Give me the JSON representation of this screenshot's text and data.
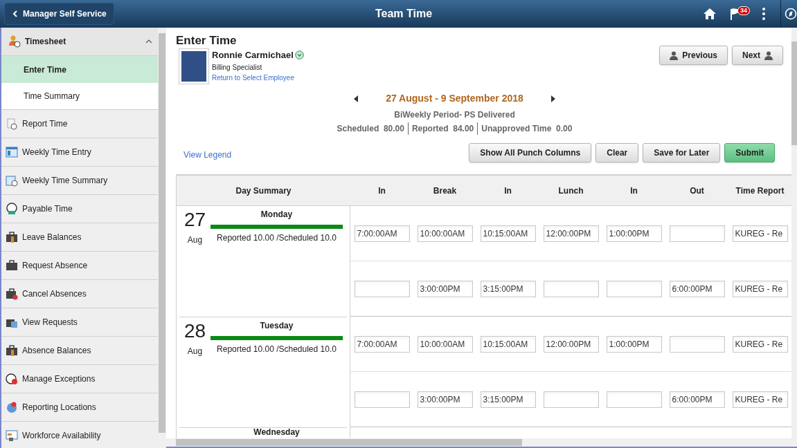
{
  "header": {
    "back_button": "Manager Self Service",
    "title": "Team Time",
    "notification_count": "34"
  },
  "sidebar": {
    "group": {
      "label": "Timesheet",
      "expanded": true,
      "children": [
        {
          "label": "Enter Time",
          "selected": true
        },
        {
          "label": "Time Summary",
          "selected": false
        }
      ]
    },
    "items": [
      {
        "label": "Report Time"
      },
      {
        "label": "Weekly Time Entry"
      },
      {
        "label": "Weekly Time Summary"
      },
      {
        "label": "Payable Time"
      },
      {
        "label": "Leave Balances"
      },
      {
        "label": "Request Absence"
      },
      {
        "label": "Cancel Absences"
      },
      {
        "label": "View Requests"
      },
      {
        "label": "Absence Balances"
      },
      {
        "label": "Manage Exceptions"
      },
      {
        "label": "Reporting Locations"
      },
      {
        "label": "Workforce Availability"
      }
    ]
  },
  "page_title": "Enter Time",
  "employee": {
    "name": "Ronnie Carmichael",
    "job_title": "Billing Specialist",
    "link": "Return to Select Employee"
  },
  "employee_nav": [
    "Previous",
    "Next"
  ],
  "period": {
    "range": "27 August - 9 September 2018",
    "type": "BiWeekly Period- PS Delivered",
    "totals": [
      {
        "label": "Scheduled",
        "value": "80.00"
      },
      {
        "label": "Reported",
        "value": "84.00"
      },
      {
        "label": "Unapproved Time",
        "value": "0.00"
      }
    ]
  },
  "legend_link": "View Legend",
  "actions": [
    {
      "label": "Show All Punch Columns",
      "kind": "secondary"
    },
    {
      "label": "Clear",
      "kind": "secondary"
    },
    {
      "label": "Save for Later",
      "kind": "secondary"
    },
    {
      "label": "Submit",
      "kind": "primary"
    }
  ],
  "table": {
    "columns": [
      "Day Summary",
      "In",
      "Break",
      "In",
      "Lunch",
      "In",
      "Out",
      "Time Report"
    ],
    "days": [
      {
        "day": "27",
        "month": "Aug",
        "weekday": "Monday",
        "level": 1,
        "summary": "Reported 10.00 /Scheduled 10.0",
        "rows": [
          [
            "7:00:00AM",
            "10:00:00AM",
            "10:15:00AM",
            "12:00:00PM",
            "1:00:00PM",
            "",
            "KUREG - Re"
          ],
          [
            "",
            "3:00:00PM",
            "3:15:00PM",
            "",
            "",
            "6:00:00PM",
            "KUREG - Re"
          ]
        ]
      },
      {
        "day": "28",
        "month": "Aug",
        "weekday": "Tuesday",
        "level": 1,
        "summary": "Reported 10.00 /Scheduled 10.0",
        "rows": [
          [
            "7:00:00AM",
            "10:00:00AM",
            "10:15:00AM",
            "12:00:00PM",
            "1:00:00PM",
            "",
            "KUREG - Re"
          ],
          [
            "",
            "3:00:00PM",
            "3:15:00PM",
            "",
            "",
            "6:00:00PM",
            "KUREG - Re"
          ]
        ]
      },
      {
        "weekday": "Wednesday"
      }
    ]
  }
}
